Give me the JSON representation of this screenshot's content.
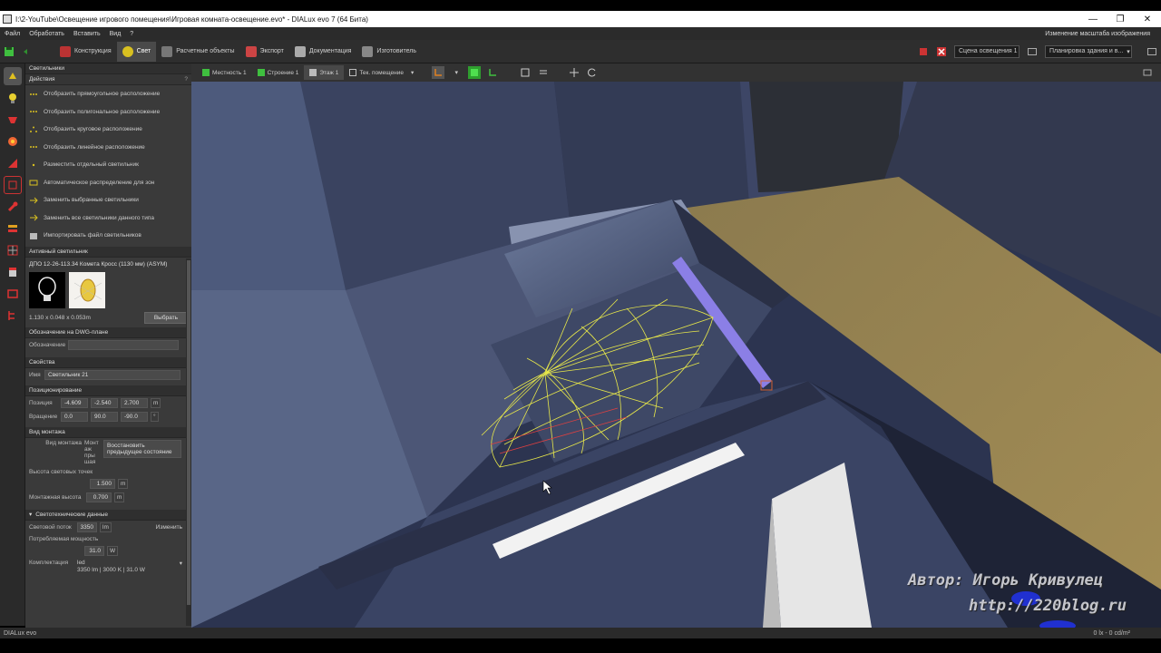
{
  "window": {
    "title": "I:\\2-YouTube\\Освещение игрового помещения\\Игровая комната-освещение.evo* - DIALux evo 7  (64 Бита)",
    "controls": [
      "—",
      "❐",
      "✕"
    ]
  },
  "menu": {
    "items": [
      "Файл",
      "Обработать",
      "Вставить",
      "Вид",
      "?"
    ],
    "right_text": "Изменение масштаба изображения"
  },
  "toolbar": {
    "modes": [
      "Конструкция",
      "Свет",
      "Расчетные объекты",
      "Экспорт",
      "Документация",
      "Изготовитель"
    ],
    "scene_select": "Сцена освещения 1",
    "plan_select": "Планировка здания и в..."
  },
  "view_toolbar": {
    "tabs": [
      "Местность 1",
      "Строение 1",
      "Этаж 1",
      "Тек. помещение"
    ]
  },
  "panel": {
    "title": "Светильники",
    "actions_header": "Действия",
    "help": "?",
    "actions": [
      "Отобразить прямоугольное расположение",
      "Отобразить полигональное расположение",
      "Отобразить круговое расположение",
      "Отобразить линейное расположение",
      "Разместить отдельный светильник",
      "Автоматическое распределение для зон",
      "Заменить выбранные светильники",
      "Заменить все светильники данного типа",
      "Импортировать файл светильников"
    ],
    "active_header": "Активный светильник",
    "active_name": "ДПО 12-26-113.34 Комета Кросс (1130 мм) (ASYM)",
    "dims": "1.130 x 0.048 x 0.053m",
    "pick_button": "Выбрать",
    "dwg_header": "Обозначение на DWG-плане",
    "dwg_label": "Обозначение",
    "props_header": "Свойства",
    "name_label": "Имя",
    "name_value": "Светильник 21",
    "pos_header": "Позиционирование",
    "pos_label": "Позиция",
    "pos_values": [
      "-4.609",
      "-2.540",
      "2.700"
    ],
    "pos_unit": "m",
    "rot_label": "Вращение",
    "rot_values": [
      "0.0",
      "90.0",
      "-90.0"
    ],
    "rot_unit": "°",
    "mount_header": "Вид монтажа",
    "mount_label": "Вид монтажа",
    "mount_value": "Монт аж пры шая",
    "restore_button": "Восстановить предыдущее состояние",
    "height_label": "Высота световых точек",
    "height_value": "1.500",
    "install_label": "Монтажная высота",
    "install_value": "0.700",
    "unit_m": "m",
    "photo_header": "Светотехнические данные",
    "flux_label": "Световой поток",
    "flux_value": "3350",
    "flux_unit": "lm",
    "change_button": "Изменить",
    "power_label": "Потребляемая мощность",
    "power_value": "31.0",
    "power_unit": "W",
    "equip_label": "Комплектация",
    "equip_value": "led",
    "equip_summary": "3350 lm  |  3000 K  |  31.0 W"
  },
  "status": {
    "left": "DIALux evo",
    "right": "0 lx - 0 cd/m²"
  },
  "watermark": {
    "author": "Автор: Игорь Кривулец",
    "url": "http://220blog.ru"
  },
  "colors": {
    "accent_green": "#3fbf3f",
    "floor": "#8a7a50",
    "wall": "#3d4866",
    "wireframe": "#e8e84a"
  }
}
